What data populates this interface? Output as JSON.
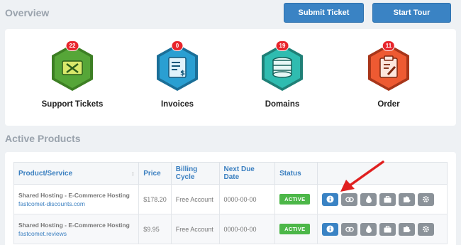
{
  "overview": {
    "title": "Overview",
    "submit_ticket_label": "Submit Ticket",
    "start_tour_label": "Start Tour"
  },
  "stats": [
    {
      "label": "Support Tickets",
      "count": "22",
      "color": "#56a638",
      "icon": "tools-ticket-icon"
    },
    {
      "label": "Invoices",
      "count": "0",
      "color": "#2a9fd2",
      "icon": "invoice-icon"
    },
    {
      "label": "Domains",
      "count": "19",
      "color": "#2fbcb0",
      "icon": "database-icon"
    },
    {
      "label": "Order",
      "count": "11",
      "color": "#ee5a32",
      "icon": "clipboard-edit-icon"
    }
  ],
  "active_products": {
    "title": "Active Products",
    "columns": [
      "Product/Service",
      "Price",
      "Billing Cycle",
      "Next Due Date",
      "Status"
    ],
    "rows": [
      {
        "name": "Shared Hosting - E-Commerce Hosting",
        "domain": "fastcomet-discounts.com",
        "price": "$178.20",
        "cycle": "Free Account",
        "due": "0000-00-00",
        "status": "ACTIVE"
      },
      {
        "name": "Shared Hosting - E-Commerce Hosting",
        "domain": "fastcomet.reviews",
        "price": "$9.95",
        "cycle": "Free Account",
        "due": "0000-00-00",
        "status": "ACTIVE"
      }
    ]
  },
  "colors": {
    "accent": "#3a83c4",
    "active": "#4cb748",
    "arrow": "#e02020",
    "badge": "#e8252c"
  }
}
